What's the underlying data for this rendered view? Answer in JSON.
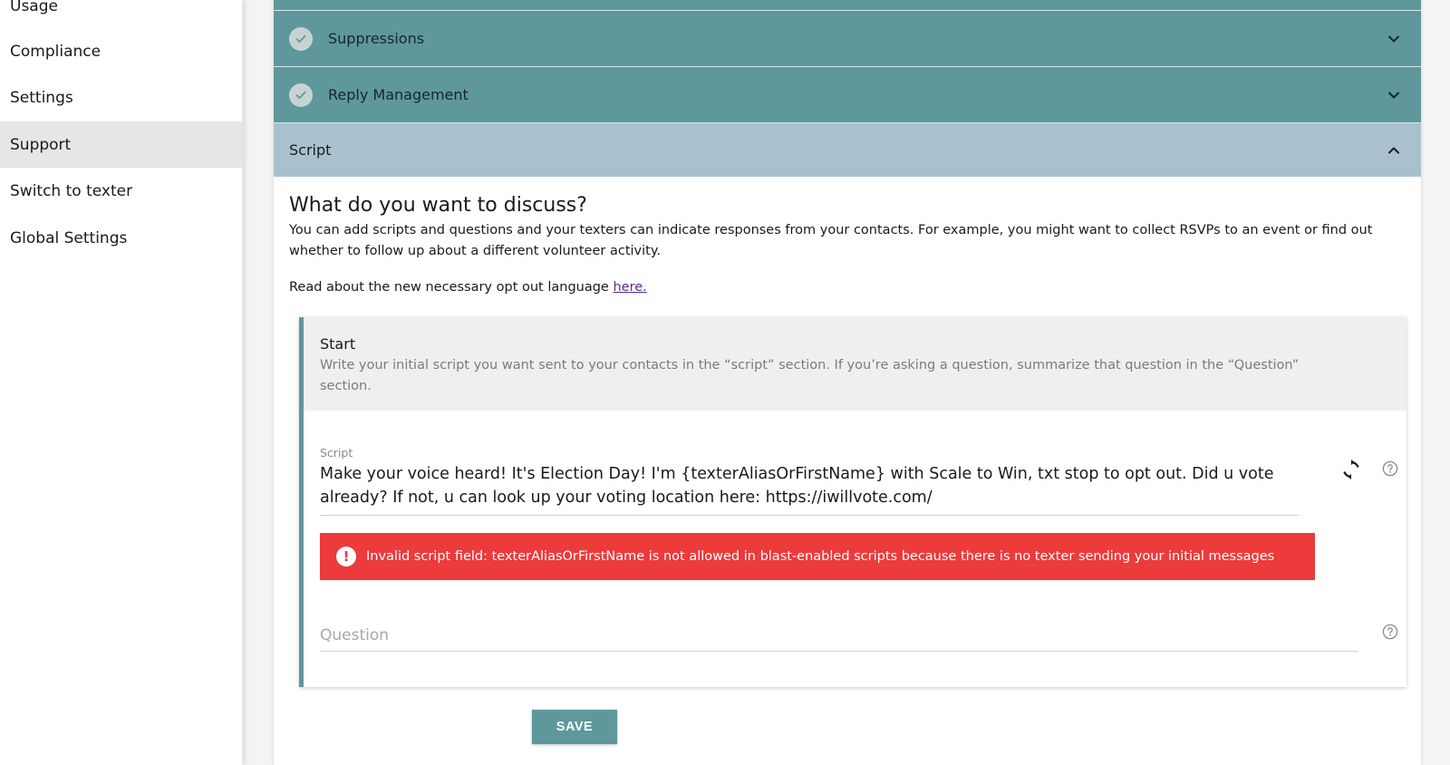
{
  "sidebar": {
    "items": [
      {
        "label": "Usage",
        "active": false
      },
      {
        "label": "Compliance",
        "active": false
      },
      {
        "label": "Settings",
        "active": false
      },
      {
        "label": "Support",
        "active": true
      },
      {
        "label": "Switch to texter",
        "active": false
      },
      {
        "label": "Global Settings",
        "active": false
      }
    ]
  },
  "accordion": {
    "suppressions": {
      "label": "Suppressions",
      "icon": "check-icon",
      "expand_icon": "chevron-down-icon"
    },
    "reply_management": {
      "label": "Reply Management",
      "icon": "check-icon",
      "expand_icon": "chevron-down-icon"
    },
    "script": {
      "label": "Script",
      "expand_icon": "chevron-up-icon"
    }
  },
  "script_section": {
    "heading": "What do you want to discuss?",
    "description": "You can add scripts and questions and your texters can indicate responses from your contacts. For example, you might want to collect RSVPs to an event or find out whether to follow up about a different volunteer activity.",
    "opt_out_text": "Read about the new necessary opt out language ",
    "opt_out_link": "here."
  },
  "step": {
    "title": "Start",
    "subtitle": "Write your initial script you want sent to your contacts in the “script” section. If you’re asking a question, summarize that question in the “Question” section.",
    "script_label": "Script",
    "script_value": "Make your voice heard! It's Election Day! I'm {texterAliasOrFirstName} with Scale to Win, txt stop to opt out. Did u vote already? If not, u can look up your voting location here: https://iwillvote.com/",
    "error_message": "Invalid script field: texterAliasOrFirstName is not allowed in blast-enabled scripts because there is no texter sending your initial messages",
    "question_placeholder": "Question"
  },
  "save_label": "SAVE",
  "colors": {
    "teal": "#5e989c",
    "open_header": "#a9c1cf",
    "error": "#ed3a3b",
    "link": "#5b2a8e"
  }
}
